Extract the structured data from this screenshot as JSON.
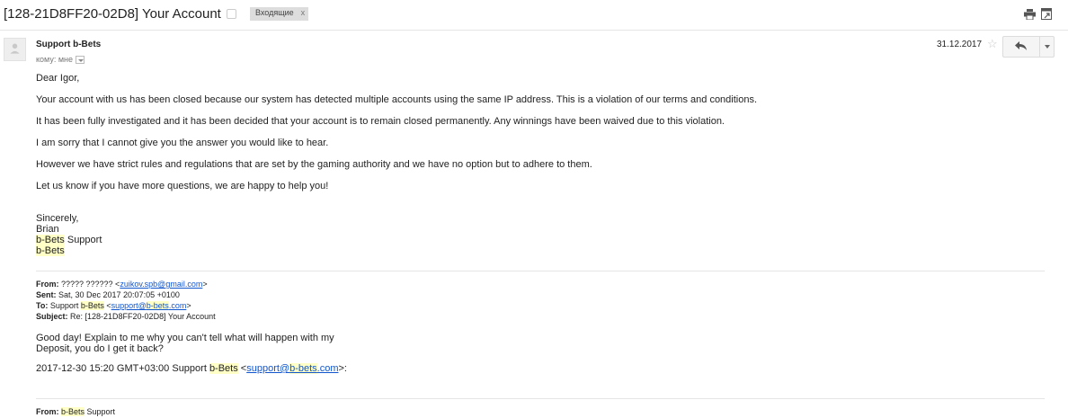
{
  "subject": {
    "title": "[128-21D8FF20-02D8] Your Account",
    "label_chip": "Входящие",
    "chip_close": "x"
  },
  "icons": {
    "label_toggle": "label-icon",
    "print": "print-icon",
    "new_window": "new-window-icon",
    "avatar": "avatar-icon",
    "star": "star-icon",
    "reply": "reply-icon",
    "more": "chevron-down-icon"
  },
  "header": {
    "sender": "Support b-Bets",
    "recipient": "кому: мне",
    "date": "31.12.2017",
    "star_glyph": "☆"
  },
  "body": {
    "greeting": "Dear Igor,",
    "paragraphs": [
      "Your account with us has been closed because our system has detected multiple accounts using the same IP address. This is a violation of our terms and conditions.",
      "It has been fully investigated and it has been decided that your account is to remain closed permanently. Any winnings have been waived due to this violation.",
      "I am sorry that I cannot give you the answer you would like to hear.",
      "However we have strict rules and regulations that are set by the gaming authority and we have no option but to adhere to them.",
      "Let us know if you have more questions, we are happy to help you!"
    ],
    "signature": {
      "closing": "Sincerely,",
      "name": "Brian",
      "team_brand": "b-Bets",
      "team_suffix": " Support",
      "brand": "b-Bets"
    }
  },
  "quoted": {
    "from_label": "From:",
    "from_name": " ????? ?????? <",
    "from_email": "zuikov.spb@gmail.com",
    "from_end": ">",
    "sent_label": "Sent:",
    "sent_value": " Sat, 30 Dec 2017 20:07:05 +0100",
    "to_label": "To:",
    "to_prefix": " Support ",
    "to_brand": "b-Bets",
    "to_mid": " <",
    "to_email_pre": "support@",
    "to_email_brand": "b-bets",
    "to_email_post": ".com",
    "to_end": ">",
    "subject_label": "Subject:",
    "subject_value": " Re: [128-21D8FF20-02D8] Your Account",
    "message_line1": "Good day! Explain to me why you can't tell what will happen with my",
    "message_line2": "Deposit, you do I get it back?",
    "attribution_prefix": "2017-12-30 15:20 GMT+03:00 Support ",
    "attribution_brand": "b-Bets",
    "attribution_mid": " <",
    "attribution_email_pre": "support@",
    "attribution_email_brand": "b-bets",
    "attribution_email_post": ".com",
    "attribution_end": ">:",
    "from2_label": "From:",
    "from2_pre": " ",
    "from2_brand": "b-Bets",
    "from2_post": " Support"
  }
}
